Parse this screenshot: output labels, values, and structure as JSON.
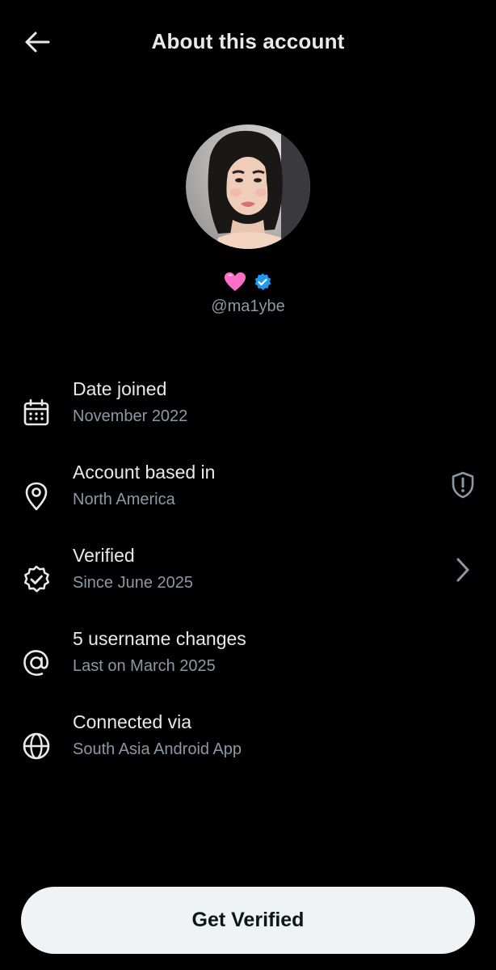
{
  "header": {
    "title": "About this account",
    "back_icon": "arrow-left-icon"
  },
  "profile": {
    "handle": "@ma1ybe",
    "emoji_icon": "pink-heart-icon",
    "verified_icon": "verified-badge-icon",
    "verified_color": "#1d9bf0",
    "heart_color": "#ff6fc8"
  },
  "details": [
    {
      "icon": "calendar-icon",
      "label": "Date joined",
      "value": "November 2022"
    },
    {
      "icon": "location-pin-icon",
      "label": "Account based in",
      "value": "North America",
      "right_icon": "shield-exclamation-icon"
    },
    {
      "icon": "verified-badge-outline-icon",
      "label": "Verified",
      "value": "Since June 2025",
      "right_icon": "chevron-right-icon"
    },
    {
      "icon": "at-sign-icon",
      "label": "5 username changes",
      "value": "Last on March 2025"
    },
    {
      "icon": "globe-icon",
      "label": "Connected via",
      "value": "South Asia Android App"
    }
  ],
  "cta": {
    "label": "Get Verified"
  },
  "colors": {
    "background": "#000000",
    "text_primary": "#e7e9ea",
    "text_secondary": "#8b98a5",
    "button_bg": "#eff3f4"
  }
}
